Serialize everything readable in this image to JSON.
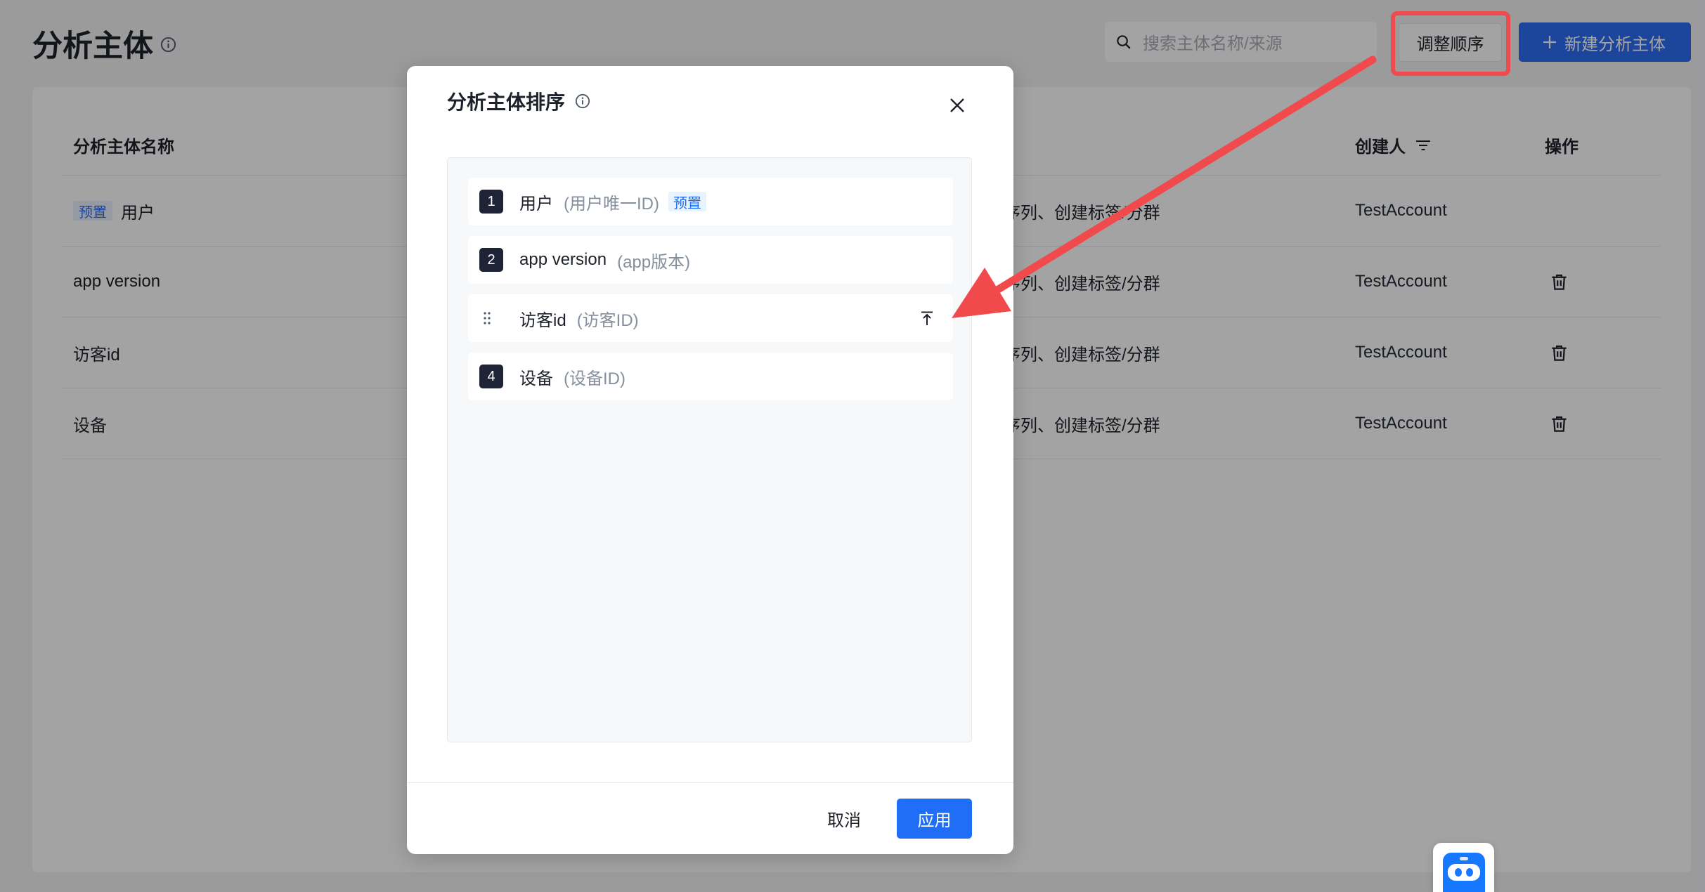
{
  "page": {
    "title": "分析主体"
  },
  "search": {
    "placeholder": "搜索主体名称/来源"
  },
  "toolbar": {
    "reorder_label": "调整顺序",
    "create_label": "新建分析主体"
  },
  "table": {
    "headers": {
      "name": "分析主体名称",
      "creator": "创建人",
      "actions": "操作"
    },
    "rows": [
      {
        "badge": "预置",
        "name": "用户",
        "usage": "序列、创建标签/分群",
        "creator": "TestAccount"
      },
      {
        "name": "app version",
        "usage": "序列、创建标签/分群",
        "creator": "TestAccount"
      },
      {
        "name": "访客id",
        "usage": "序列、创建标签/分群",
        "creator": "TestAccount"
      },
      {
        "name": "设备",
        "usage": "序列、创建标签/分群",
        "creator": "TestAccount"
      }
    ]
  },
  "modal": {
    "title": "分析主体排序",
    "items": [
      {
        "index": "1",
        "name": "用户",
        "id_label": "(用户唯一ID)",
        "badge": "预置"
      },
      {
        "index": "2",
        "name": "app version",
        "id_label": "(app版本)"
      },
      {
        "name": "访客id",
        "id_label": "(访客ID)",
        "hovered": true
      },
      {
        "index": "4",
        "name": "设备",
        "id_label": "(设备ID)"
      }
    ],
    "cancel_label": "取消",
    "apply_label": "应用"
  },
  "icons": {
    "title_info": "info-icon",
    "search": "search-icon",
    "create": "plus-icon",
    "creator_filter": "filter-icon",
    "row_delete": "trash-icon",
    "modal_close": "close-icon",
    "drag": "drag-handle-icon",
    "move_top": "pin-to-top-icon",
    "assistant": "robot-icon"
  },
  "colors": {
    "primary": "#2d6cf5",
    "apply_button": "#1f6ef5",
    "index_badge": "#1f2336",
    "preset_badge_bg": "#e8f0fe",
    "annotation": "#f04a4d",
    "mask": "rgba(0,0,0,0.36)"
  }
}
